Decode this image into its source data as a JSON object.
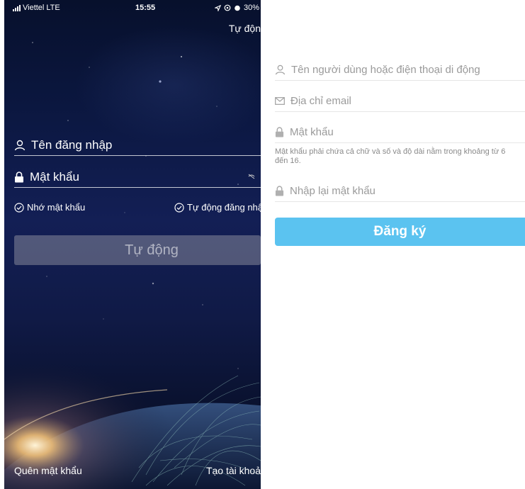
{
  "login": {
    "status_bar": {
      "carrier": "Viettel",
      "network": "LTE",
      "time": "15:55",
      "battery": "30%"
    },
    "top_link": "Tự độn",
    "username_placeholder": "Tên đăng nhập",
    "password_placeholder": "Mật khẩu",
    "remember_label": "Nhớ mật khẩu",
    "autologin_label": "Tự động đăng nhậ",
    "login_button": "Tự động",
    "forgot_link": "Quên mật khẩu",
    "create_link": "Tạo tài khoả"
  },
  "register": {
    "name_placeholder": "Tên người dùng hoặc điện thoại di động",
    "email_placeholder": "Địa chỉ email",
    "password_placeholder": "Mật khẩu",
    "password_hint": "Mật khẩu phải chứa cả chữ và số và độ dài nằm trong khoảng từ 6 đến 16.",
    "confirm_placeholder": "Nhập lại mật khẩu",
    "register_button": "Đăng ký"
  },
  "colors": {
    "register_button": "#5bc3f0",
    "login_bg": "#0b1740"
  }
}
